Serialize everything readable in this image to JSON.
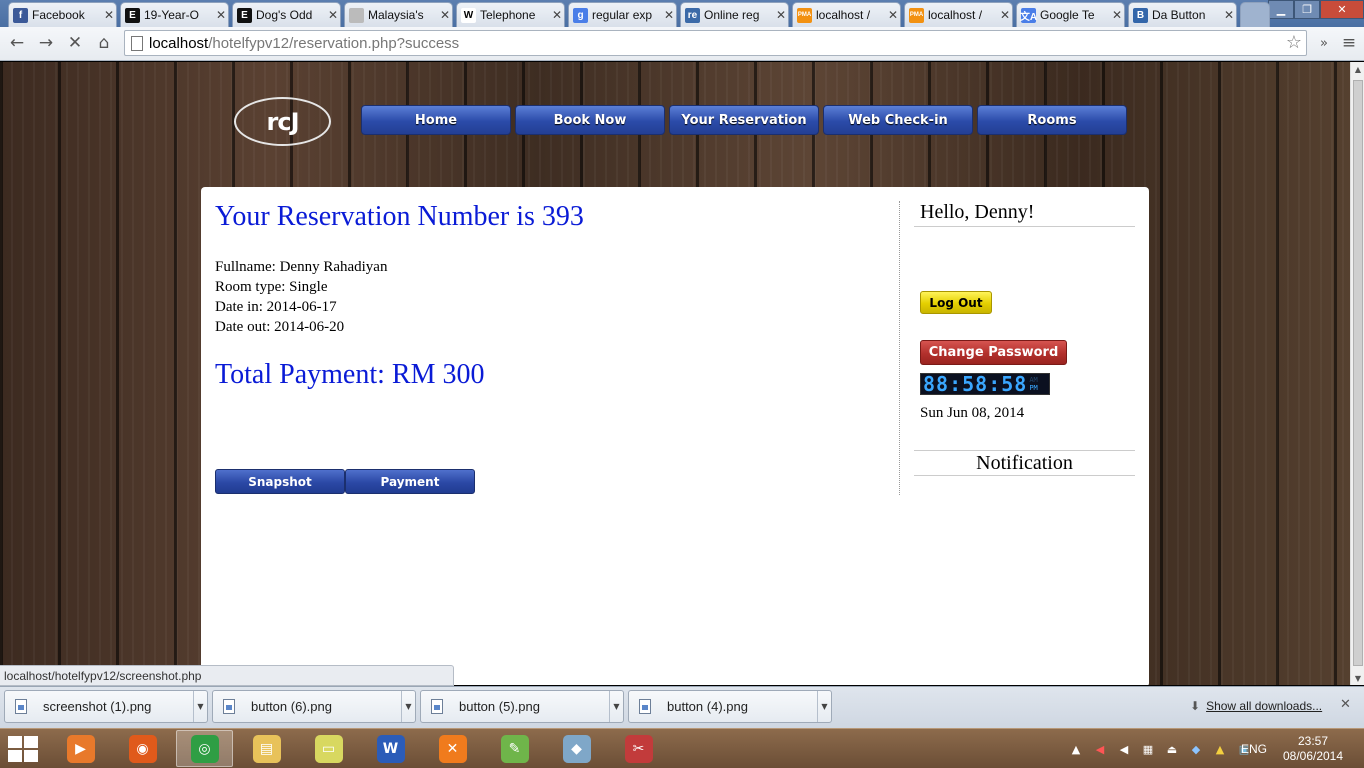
{
  "browser": {
    "tabs": [
      {
        "title": "Facebook",
        "icon": "facebook-icon",
        "fav": "f",
        "color": "#3b5998"
      },
      {
        "title": "19-Year-O",
        "icon": "e-site-icon",
        "fav": "E",
        "color": "#111111"
      },
      {
        "title": "Dog's Odd",
        "icon": "e-site-icon",
        "fav": "E",
        "color": "#111111"
      },
      {
        "title": "Malaysia's",
        "icon": "loading-icon",
        "fav": "",
        "color": "#bbbbbb"
      },
      {
        "title": "Telephone",
        "icon": "wikipedia-icon",
        "fav": "W",
        "color": "#ffffff"
      },
      {
        "title": "regular exp",
        "icon": "google-icon",
        "fav": "g",
        "color": "#4a7ee8"
      },
      {
        "title": "Online reg",
        "icon": "regex101-icon",
        "fav": "re",
        "color": "#3b6aa8"
      },
      {
        "title": "localhost /",
        "icon": "phpmyadmin-icon",
        "fav": "PMA",
        "color": "#f29111"
      },
      {
        "title": "localhost /",
        "icon": "phpmyadmin-icon",
        "fav": "PMA",
        "color": "#f29111"
      },
      {
        "title": "Google Te",
        "icon": "google-translate-icon",
        "fav": "文A",
        "color": "#4a7ee8"
      },
      {
        "title": "Da Button",
        "icon": "b-site-icon",
        "fav": "B",
        "color": "#3366aa"
      }
    ],
    "url_host": "localhost",
    "url_path": "/hotelfypv12/reservation.php?success",
    "status_url": "localhost/hotelfypv12/screenshot.php"
  },
  "site": {
    "logo_text": "rcJ",
    "nav": [
      "Home",
      "Book Now",
      "Your Reservation",
      "Web Check-in",
      "Rooms"
    ]
  },
  "reservation": {
    "heading": "Your Reservation Number is 393",
    "fullname": "Fullname: Denny Rahadiyan",
    "room_type": "Room type: Single",
    "date_in": "Date in: 2014-06-17",
    "date_out": "Date out: 2014-06-20",
    "total": "Total Payment: RM 300",
    "snapshot_label": "Snapshot",
    "payment_label": "Payment"
  },
  "sidebar": {
    "greeting": "Hello, Denny!",
    "logout_label": "Log Out",
    "change_password_label": "Change Password",
    "clock_digits": "88:58:58",
    "clock_am": "AM",
    "clock_pm": "PM",
    "date": "Sun Jun 08, 2014",
    "notification_title": "Notification"
  },
  "downloads": {
    "items": [
      "screenshot (1).png",
      "button (6).png",
      "button (5).png",
      "button (4).png"
    ],
    "show_all": "Show all downloads..."
  },
  "taskbar": {
    "apps": [
      {
        "name": "media-player-icon",
        "glyph": "▶",
        "color": "#e8792b"
      },
      {
        "name": "firefox-icon",
        "glyph": "◉",
        "color": "#e05a1b"
      },
      {
        "name": "chrome-icon",
        "glyph": "◎",
        "color": "#2f9e44"
      },
      {
        "name": "file-explorer-icon",
        "glyph": "▤",
        "color": "#e8c25a"
      },
      {
        "name": "sticky-notes-icon",
        "glyph": "▭",
        "color": "#d8d860"
      },
      {
        "name": "word-icon",
        "glyph": "W",
        "color": "#2b5cb8"
      },
      {
        "name": "xampp-icon",
        "glyph": "✕",
        "color": "#f07b1d"
      },
      {
        "name": "notepad-plus-icon",
        "glyph": "✎",
        "color": "#6fb54a"
      },
      {
        "name": "app-window-icon",
        "glyph": "◆",
        "color": "#7fa7c8"
      },
      {
        "name": "snipping-tool-icon",
        "glyph": "✂",
        "color": "#c23b3b"
      }
    ],
    "language": "ENG",
    "time": "23:57",
    "date": "08/06/2014"
  }
}
